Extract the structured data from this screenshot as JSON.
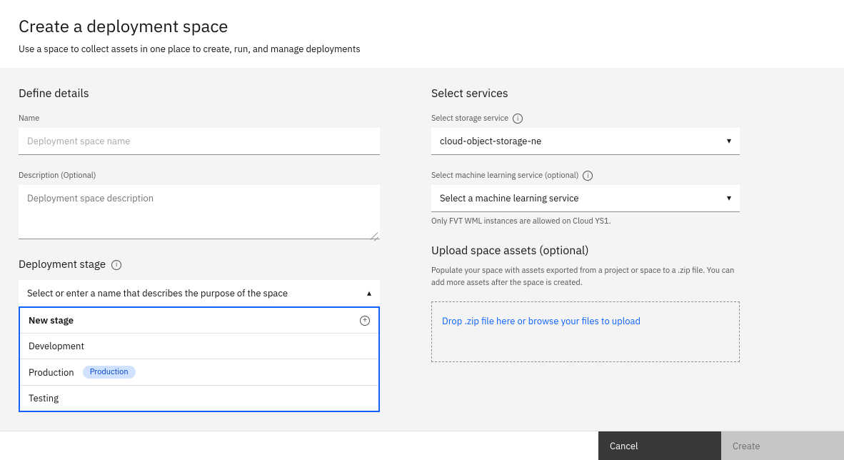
{
  "header": {
    "title": "Create a deployment space",
    "subtitle": "Use a space to collect assets in one place to create, run, and manage deployments"
  },
  "details": {
    "section_title": "Define details",
    "name_label": "Name",
    "name_placeholder": "Deployment space name",
    "desc_label": "Description (Optional)",
    "desc_placeholder": "Deployment space description"
  },
  "stage": {
    "title": "Deployment stage",
    "select_placeholder": "Select or enter a name that describes the purpose of the space",
    "options": {
      "new": "New stage",
      "development": "Development",
      "production": "Production",
      "production_badge": "Production",
      "testing": "Testing"
    }
  },
  "services": {
    "section_title": "Select services",
    "storage_label": "Select storage service",
    "storage_value": "cloud-object-storage-ne",
    "ml_label": "Select machine learning service (optional)",
    "ml_placeholder": "Select a machine learning service",
    "ml_helper": "Only FVT WML instances are allowed on Cloud YS1."
  },
  "upload": {
    "title": "Upload space assets (optional)",
    "description": "Populate your space with assets exported from a project or space to a .zip file. You can add more assets after the space is created.",
    "dropzone_prefix": "Drop .zip file here or ",
    "dropzone_link": "browse your files to upload"
  },
  "footer": {
    "cancel": "Cancel",
    "create": "Create"
  }
}
